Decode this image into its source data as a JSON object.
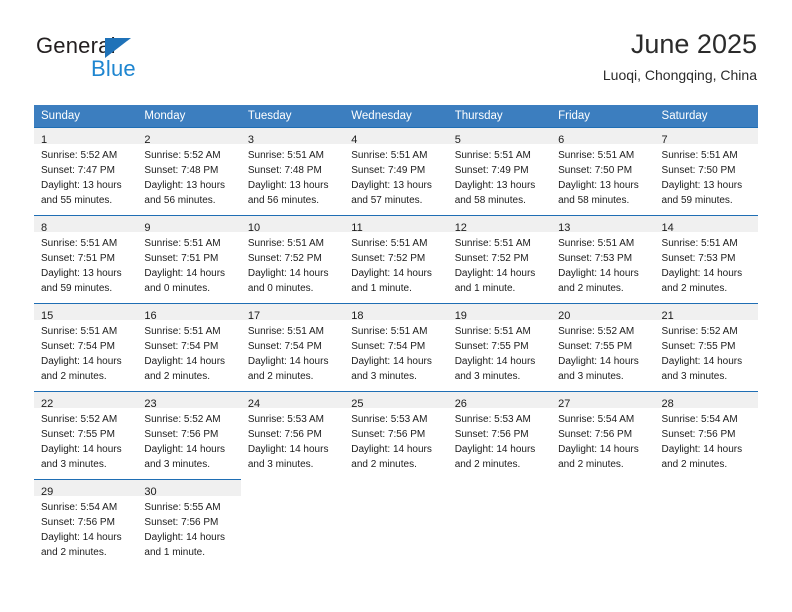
{
  "brand": {
    "name_top": "General",
    "name_bottom": "Blue",
    "flag_color": "#1f72b8",
    "blue_text_color": "#1f86d0"
  },
  "header": {
    "month_title": "June 2025",
    "location": "Luoqi, Chongqing, China"
  },
  "theme": {
    "header_row_bg": "#3c7ebf",
    "cell_band_bg": "#f0f0f0",
    "cell_border": "#1f6eb4"
  },
  "calendar": {
    "weekday_headers": [
      "Sunday",
      "Monday",
      "Tuesday",
      "Wednesday",
      "Thursday",
      "Friday",
      "Saturday"
    ],
    "weeks": [
      [
        {
          "day": "1",
          "sunrise": "Sunrise: 5:52 AM",
          "sunset": "Sunset: 7:47 PM",
          "daylight": "Daylight: 13 hours and 55 minutes."
        },
        {
          "day": "2",
          "sunrise": "Sunrise: 5:52 AM",
          "sunset": "Sunset: 7:48 PM",
          "daylight": "Daylight: 13 hours and 56 minutes."
        },
        {
          "day": "3",
          "sunrise": "Sunrise: 5:51 AM",
          "sunset": "Sunset: 7:48 PM",
          "daylight": "Daylight: 13 hours and 56 minutes."
        },
        {
          "day": "4",
          "sunrise": "Sunrise: 5:51 AM",
          "sunset": "Sunset: 7:49 PM",
          "daylight": "Daylight: 13 hours and 57 minutes."
        },
        {
          "day": "5",
          "sunrise": "Sunrise: 5:51 AM",
          "sunset": "Sunset: 7:49 PM",
          "daylight": "Daylight: 13 hours and 58 minutes."
        },
        {
          "day": "6",
          "sunrise": "Sunrise: 5:51 AM",
          "sunset": "Sunset: 7:50 PM",
          "daylight": "Daylight: 13 hours and 58 minutes."
        },
        {
          "day": "7",
          "sunrise": "Sunrise: 5:51 AM",
          "sunset": "Sunset: 7:50 PM",
          "daylight": "Daylight: 13 hours and 59 minutes."
        }
      ],
      [
        {
          "day": "8",
          "sunrise": "Sunrise: 5:51 AM",
          "sunset": "Sunset: 7:51 PM",
          "daylight": "Daylight: 13 hours and 59 minutes."
        },
        {
          "day": "9",
          "sunrise": "Sunrise: 5:51 AM",
          "sunset": "Sunset: 7:51 PM",
          "daylight": "Daylight: 14 hours and 0 minutes."
        },
        {
          "day": "10",
          "sunrise": "Sunrise: 5:51 AM",
          "sunset": "Sunset: 7:52 PM",
          "daylight": "Daylight: 14 hours and 0 minutes."
        },
        {
          "day": "11",
          "sunrise": "Sunrise: 5:51 AM",
          "sunset": "Sunset: 7:52 PM",
          "daylight": "Daylight: 14 hours and 1 minute."
        },
        {
          "day": "12",
          "sunrise": "Sunrise: 5:51 AM",
          "sunset": "Sunset: 7:52 PM",
          "daylight": "Daylight: 14 hours and 1 minute."
        },
        {
          "day": "13",
          "sunrise": "Sunrise: 5:51 AM",
          "sunset": "Sunset: 7:53 PM",
          "daylight": "Daylight: 14 hours and 2 minutes."
        },
        {
          "day": "14",
          "sunrise": "Sunrise: 5:51 AM",
          "sunset": "Sunset: 7:53 PM",
          "daylight": "Daylight: 14 hours and 2 minutes."
        }
      ],
      [
        {
          "day": "15",
          "sunrise": "Sunrise: 5:51 AM",
          "sunset": "Sunset: 7:54 PM",
          "daylight": "Daylight: 14 hours and 2 minutes."
        },
        {
          "day": "16",
          "sunrise": "Sunrise: 5:51 AM",
          "sunset": "Sunset: 7:54 PM",
          "daylight": "Daylight: 14 hours and 2 minutes."
        },
        {
          "day": "17",
          "sunrise": "Sunrise: 5:51 AM",
          "sunset": "Sunset: 7:54 PM",
          "daylight": "Daylight: 14 hours and 2 minutes."
        },
        {
          "day": "18",
          "sunrise": "Sunrise: 5:51 AM",
          "sunset": "Sunset: 7:54 PM",
          "daylight": "Daylight: 14 hours and 3 minutes."
        },
        {
          "day": "19",
          "sunrise": "Sunrise: 5:51 AM",
          "sunset": "Sunset: 7:55 PM",
          "daylight": "Daylight: 14 hours and 3 minutes."
        },
        {
          "day": "20",
          "sunrise": "Sunrise: 5:52 AM",
          "sunset": "Sunset: 7:55 PM",
          "daylight": "Daylight: 14 hours and 3 minutes."
        },
        {
          "day": "21",
          "sunrise": "Sunrise: 5:52 AM",
          "sunset": "Sunset: 7:55 PM",
          "daylight": "Daylight: 14 hours and 3 minutes."
        }
      ],
      [
        {
          "day": "22",
          "sunrise": "Sunrise: 5:52 AM",
          "sunset": "Sunset: 7:55 PM",
          "daylight": "Daylight: 14 hours and 3 minutes."
        },
        {
          "day": "23",
          "sunrise": "Sunrise: 5:52 AM",
          "sunset": "Sunset: 7:56 PM",
          "daylight": "Daylight: 14 hours and 3 minutes."
        },
        {
          "day": "24",
          "sunrise": "Sunrise: 5:53 AM",
          "sunset": "Sunset: 7:56 PM",
          "daylight": "Daylight: 14 hours and 3 minutes."
        },
        {
          "day": "25",
          "sunrise": "Sunrise: 5:53 AM",
          "sunset": "Sunset: 7:56 PM",
          "daylight": "Daylight: 14 hours and 2 minutes."
        },
        {
          "day": "26",
          "sunrise": "Sunrise: 5:53 AM",
          "sunset": "Sunset: 7:56 PM",
          "daylight": "Daylight: 14 hours and 2 minutes."
        },
        {
          "day": "27",
          "sunrise": "Sunrise: 5:54 AM",
          "sunset": "Sunset: 7:56 PM",
          "daylight": "Daylight: 14 hours and 2 minutes."
        },
        {
          "day": "28",
          "sunrise": "Sunrise: 5:54 AM",
          "sunset": "Sunset: 7:56 PM",
          "daylight": "Daylight: 14 hours and 2 minutes."
        }
      ],
      [
        {
          "day": "29",
          "sunrise": "Sunrise: 5:54 AM",
          "sunset": "Sunset: 7:56 PM",
          "daylight": "Daylight: 14 hours and 2 minutes."
        },
        {
          "day": "30",
          "sunrise": "Sunrise: 5:55 AM",
          "sunset": "Sunset: 7:56 PM",
          "daylight": "Daylight: 14 hours and 1 minute."
        },
        null,
        null,
        null,
        null,
        null
      ]
    ]
  }
}
